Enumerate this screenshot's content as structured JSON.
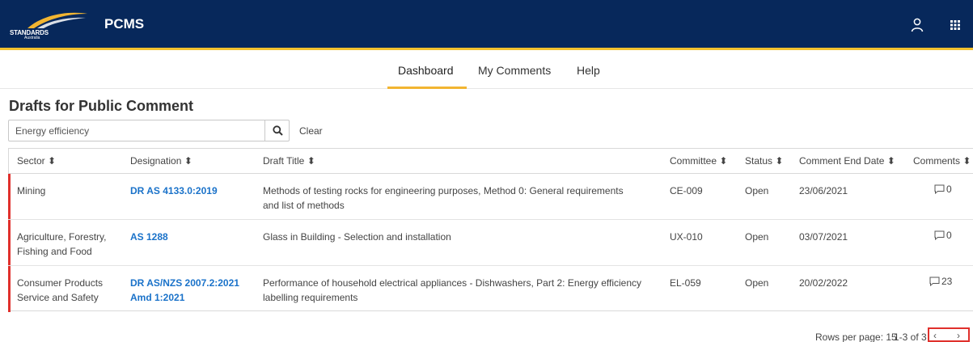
{
  "header": {
    "logo_text": "STANDARDS",
    "logo_subtext": "Australia",
    "app_title": "PCMS",
    "brand_color": "#07285b",
    "accent_color": "#f2c12e",
    "icons": [
      "user-icon",
      "apps-grid-icon"
    ]
  },
  "nav": {
    "items": [
      "Dashboard",
      "My Comments",
      "Help"
    ],
    "active": "Dashboard"
  },
  "page": {
    "title": "Drafts for Public Comment"
  },
  "search": {
    "value": "Energy efficiency",
    "clear_label": "Clear"
  },
  "table": {
    "columns": [
      "Sector",
      "Designation",
      "Draft Title",
      "Committee",
      "Status",
      "Comment End Date",
      "Comments"
    ],
    "rows": [
      {
        "sector": [
          "Mining"
        ],
        "designation": [
          "DR AS 4133.0:2019"
        ],
        "title": [
          "Methods of testing rocks for engineering purposes, Method 0: General requirements",
          "and list of methods"
        ],
        "committee": "CE-009",
        "status": "Open",
        "end_date": "23/06/2021",
        "comments": "0"
      },
      {
        "sector": [
          "Agriculture, Forestry,",
          "Fishing and Food"
        ],
        "designation": [
          "AS 1288"
        ],
        "title": [
          "Glass in Building - Selection and installation"
        ],
        "committee": "UX-010",
        "status": "Open",
        "end_date": "03/07/2021",
        "comments": "0"
      },
      {
        "sector": [
          "Consumer Products",
          "Service and Safety"
        ],
        "designation": [
          "DR AS/NZS 2007.2:2021",
          "Amd 1:2021"
        ],
        "title": [
          "Performance of household electrical appliances - Dishwashers, Part 2: Energy efficiency",
          "labelling requirements"
        ],
        "committee": "EL-059",
        "status": "Open",
        "end_date": "20/02/2022",
        "comments": "23"
      }
    ]
  },
  "pagination": {
    "rows_per_page": "Rows per page: 15",
    "range": "1-3 of 3",
    "prev": "‹",
    "next": "›",
    "highlight_color": "#e0302c"
  }
}
